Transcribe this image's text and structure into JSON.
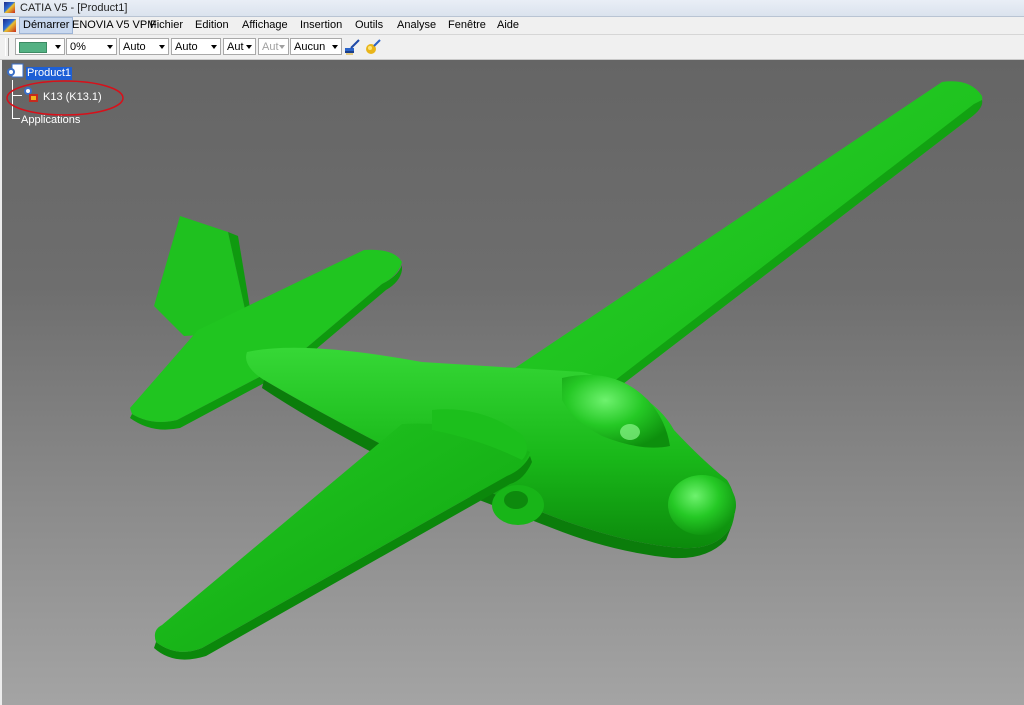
{
  "window": {
    "title": "CATIA V5 - [Product1]"
  },
  "menubar": {
    "items": [
      "Démarrer",
      "ENOVIA V5 VPM",
      "Fichier",
      "Edition",
      "Affichage",
      "Insertion",
      "Outils",
      "Analyse",
      "Fenêtre",
      "Aide"
    ]
  },
  "toolbar": {
    "fill_color": "#53b183",
    "transparency": "0%",
    "line_thickness": "Auto",
    "line_type": "Auto",
    "layer_auto": "Aut",
    "disabled_auto": "Aut",
    "layer": "Aucun",
    "icons": [
      "brush-icon",
      "format-painter-icon"
    ]
  },
  "tree": {
    "root": "Product1",
    "child": "K13 (K13.1)",
    "applications": "Applications"
  },
  "annotation": {
    "color": "#d8101a"
  },
  "model": {
    "name": "glider",
    "color": "#1fc51f"
  }
}
